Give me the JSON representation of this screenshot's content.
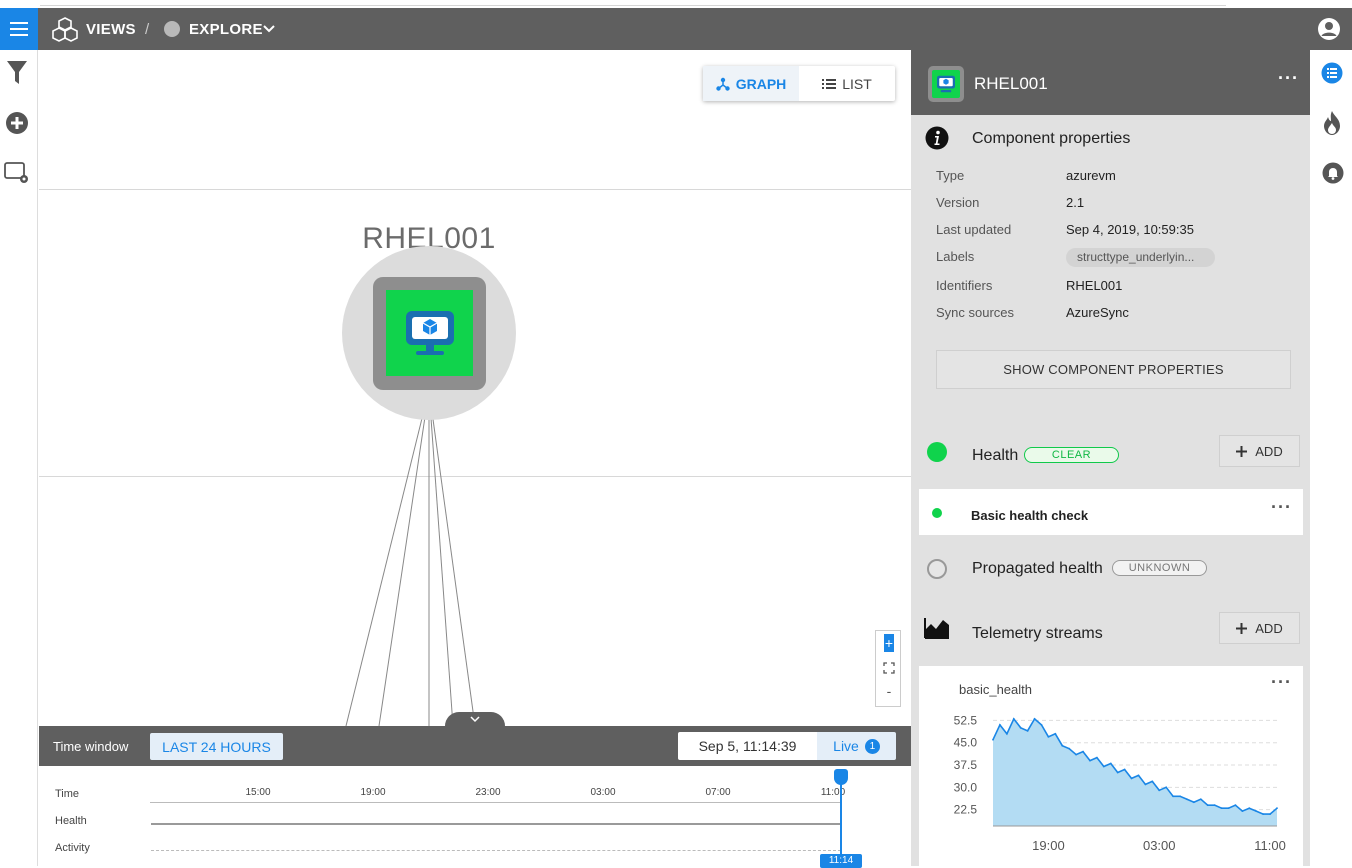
{
  "header": {
    "views_label": "VIEWS",
    "separator": "/",
    "explore_label": "EXPLORE"
  },
  "graph": {
    "toggle": {
      "graph_label": "GRAPH",
      "list_label": "LIST"
    },
    "node": {
      "title": "RHEL001"
    },
    "zoom": {
      "plus": "+",
      "minus": "-"
    }
  },
  "time_window": {
    "label": "Time window",
    "range": "LAST 24 HOURS",
    "current": "Sep 5, 11:14:39",
    "live_label": "Live",
    "live_count": "1",
    "timeline": {
      "rows": [
        "Time",
        "Health",
        "Activity"
      ],
      "ticks": [
        "15:00",
        "19:00",
        "23:00",
        "03:00",
        "07:00",
        "11:00"
      ],
      "cursor_label": "11:14"
    }
  },
  "panel": {
    "title": "RHEL001",
    "more": "···",
    "properties": {
      "title": "Component properties",
      "rows": [
        {
          "key": "Type",
          "value": "azurevm"
        },
        {
          "key": "Version",
          "value": "2.1"
        },
        {
          "key": "Last updated",
          "value": "Sep 4, 2019, 10:59:35"
        },
        {
          "key": "Labels",
          "value": "structtype_underlyin..."
        },
        {
          "key": "Identifiers",
          "value": "RHEL001"
        },
        {
          "key": "Sync sources",
          "value": "AzureSync"
        }
      ],
      "show_button": "SHOW COMPONENT PROPERTIES"
    },
    "health": {
      "title": "Health",
      "state": "CLEAR",
      "add_label": "ADD",
      "check_name": "Basic health check",
      "propagated_title": "Propagated health",
      "propagated_state": "UNKNOWN",
      "colors": {
        "clear": "#10d34c",
        "unknown": "#999999"
      }
    },
    "telemetry": {
      "title": "Telemetry streams",
      "add_label": "ADD",
      "stream_name": "basic_health"
    }
  },
  "accent": "#1a86e6",
  "chart_data": {
    "type": "area",
    "title": "basic_health",
    "x": [
      "15:00",
      "15:30",
      "16:00",
      "16:30",
      "17:00",
      "17:30",
      "18:00",
      "18:30",
      "19:00",
      "19:30",
      "20:00",
      "20:30",
      "21:00",
      "21:30",
      "22:00",
      "22:30",
      "23:00",
      "23:30",
      "00:00",
      "00:30",
      "01:00",
      "01:30",
      "02:00",
      "02:30",
      "03:00",
      "03:30",
      "04:00",
      "04:30",
      "05:00",
      "05:30",
      "06:00",
      "06:30",
      "07:00",
      "07:30",
      "08:00",
      "08:30",
      "09:00",
      "09:30",
      "10:00",
      "10:30",
      "11:00",
      "11:14"
    ],
    "values": [
      46,
      51,
      48,
      53,
      50,
      49,
      53,
      51,
      47,
      48,
      44,
      43,
      41,
      42,
      39,
      40,
      37,
      38,
      35,
      36,
      33,
      34,
      31,
      32,
      29,
      30,
      27,
      27,
      26,
      25,
      26,
      24,
      24,
      23,
      23,
      24,
      22,
      23,
      22,
      21,
      21,
      23
    ],
    "xlabel": "",
    "ylabel": "",
    "ytick_labels": [
      "52.5",
      "45.0",
      "37.5",
      "30.0",
      "22.5"
    ],
    "xtick_labels": [
      "19:00",
      "03:00",
      "11:00"
    ],
    "ylim": [
      17,
      56
    ],
    "grid": true,
    "color": "#1a86e6"
  }
}
